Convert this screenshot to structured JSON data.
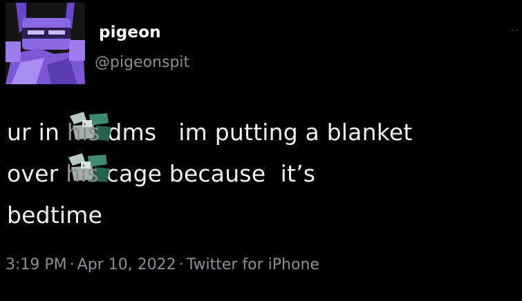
{
  "author": {
    "display_name": "pigeon",
    "handle": "@pigeonspit"
  },
  "tweet": {
    "line1_before": "ur in ",
    "line1_sticker_word": "his",
    "line1_after": " dms   im putting a blanket",
    "line2_before": "over ",
    "line2_sticker_word": "his",
    "line2_after": " cage because  it’s",
    "line3": "bedtime"
  },
  "meta": {
    "time": "3:19 PM",
    "separator": "·",
    "date": "Apr 10, 2022",
    "source": "Twitter for iPhone"
  },
  "icons": {
    "more": "more-dots-icon",
    "sticker": "pixel-character-sticker-icon"
  },
  "colors": {
    "background": "#000000",
    "text": "#f0f0f0",
    "secondary": "#8b8f93",
    "avatar_accent": "#7c58d6",
    "sticker_accent": "#3f8a72"
  }
}
